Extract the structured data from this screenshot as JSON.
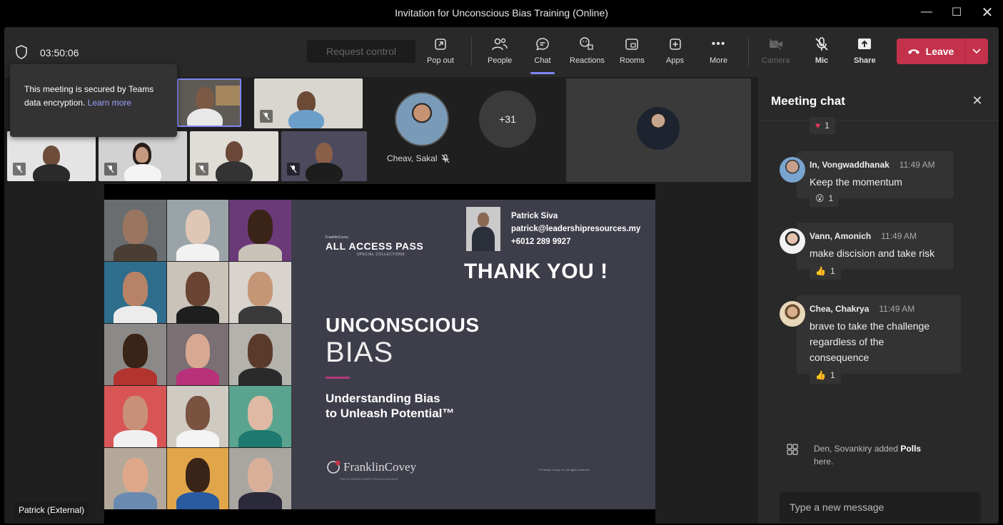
{
  "window": {
    "title": "Invitation for Unconscious Bias Training (Online)"
  },
  "topbar": {
    "timer": "03:50:06",
    "request_control": "Request control",
    "items": [
      {
        "label": "Pop out"
      },
      {
        "label": "People"
      },
      {
        "label": "Chat"
      },
      {
        "label": "Reactions"
      },
      {
        "label": "Rooms"
      },
      {
        "label": "Apps"
      },
      {
        "label": "More"
      },
      {
        "label": "Camera"
      },
      {
        "label": "Mic"
      },
      {
        "label": "Share"
      }
    ],
    "leave": "Leave"
  },
  "security_tooltip": {
    "text": "This meeting is secured by Teams data encryption.",
    "link": "Learn more"
  },
  "participants": {
    "featured_name": "Cheav, Sakal",
    "overflow_count": "+31"
  },
  "slide": {
    "brand_small": "FranklinCovey",
    "brand": "ALL ACCESS PASS",
    "brand_sub": "SPECIAL COLLECTIONS",
    "presenter": {
      "name": "Patrick Siva",
      "email": "patrick@leadershipresources.my",
      "phone": "+6012 289 9927"
    },
    "thanks": "THANK YOU !",
    "heading1": "UNCONSCIOUS",
    "heading2": "BIAS",
    "subtitle_line1": "Understanding Bias",
    "subtitle_line2": "to Unleash Potential™",
    "logo_text": "FranklinCovey",
    "logo_tag": "THE ULTIMATE COMPETITIVE ADVANTAGE",
    "copyright": "© Franklin Covey Co. All rights reserved."
  },
  "self_label": "Patrick (External)",
  "chat": {
    "title": "Meeting chat",
    "top_reaction": {
      "emoji": "♥",
      "count": "1"
    },
    "messages": [
      {
        "name": "In, Vongwaddhanak",
        "time": "11:49 AM",
        "text": "Keep the momentum",
        "reaction_emoji": "😮",
        "reaction_count": "1"
      },
      {
        "name": "Vann, Amonich",
        "time": "11:49 AM",
        "text": "make discision and take risk",
        "reaction_emoji": "👍",
        "reaction_count": "1"
      },
      {
        "name": "Chea, Chakrya",
        "time": "11:49 AM",
        "text_line1": "brave to take the challenge",
        "text_line2": "regardless of the",
        "text_line3": "consequence",
        "reaction_emoji": "👍",
        "reaction_count": "1"
      }
    ],
    "system_prefix": "Den, Sovankiry added ",
    "system_bold": "Polls",
    "system_suffix": "here.",
    "compose_placeholder": "Type a new message"
  },
  "colors": {
    "leave": "#c4314b",
    "accent": "#7f85f5",
    "slide_bg": "#3d3e4a",
    "panel": "#292929"
  }
}
